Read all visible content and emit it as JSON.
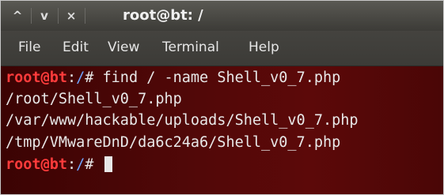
{
  "window": {
    "title": "root@bt: /",
    "buttons": {
      "up": "^",
      "down": "v",
      "close": "×"
    }
  },
  "menu": [
    "File",
    "Edit",
    "View",
    "Terminal",
    "Help"
  ],
  "terminal": {
    "prompt_user": "root@bt",
    "prompt_sep": ":",
    "prompt_path": "/",
    "prompt_end": "# ",
    "command": "find / -name Shell_v0_7.php",
    "results": [
      "/root/Shell_v0_7.php",
      "/var/www/hackable/uploads/Shell_v0_7.php",
      "/tmp/VMwareDnD/da6c24a6/Shell_v0_7.php"
    ]
  },
  "colors": {
    "prompt_user": "#ff3b3b",
    "prompt_path": "#6fa3ff",
    "terminal_bg": "#520808",
    "titlebar_bg": "#3c3b37"
  }
}
